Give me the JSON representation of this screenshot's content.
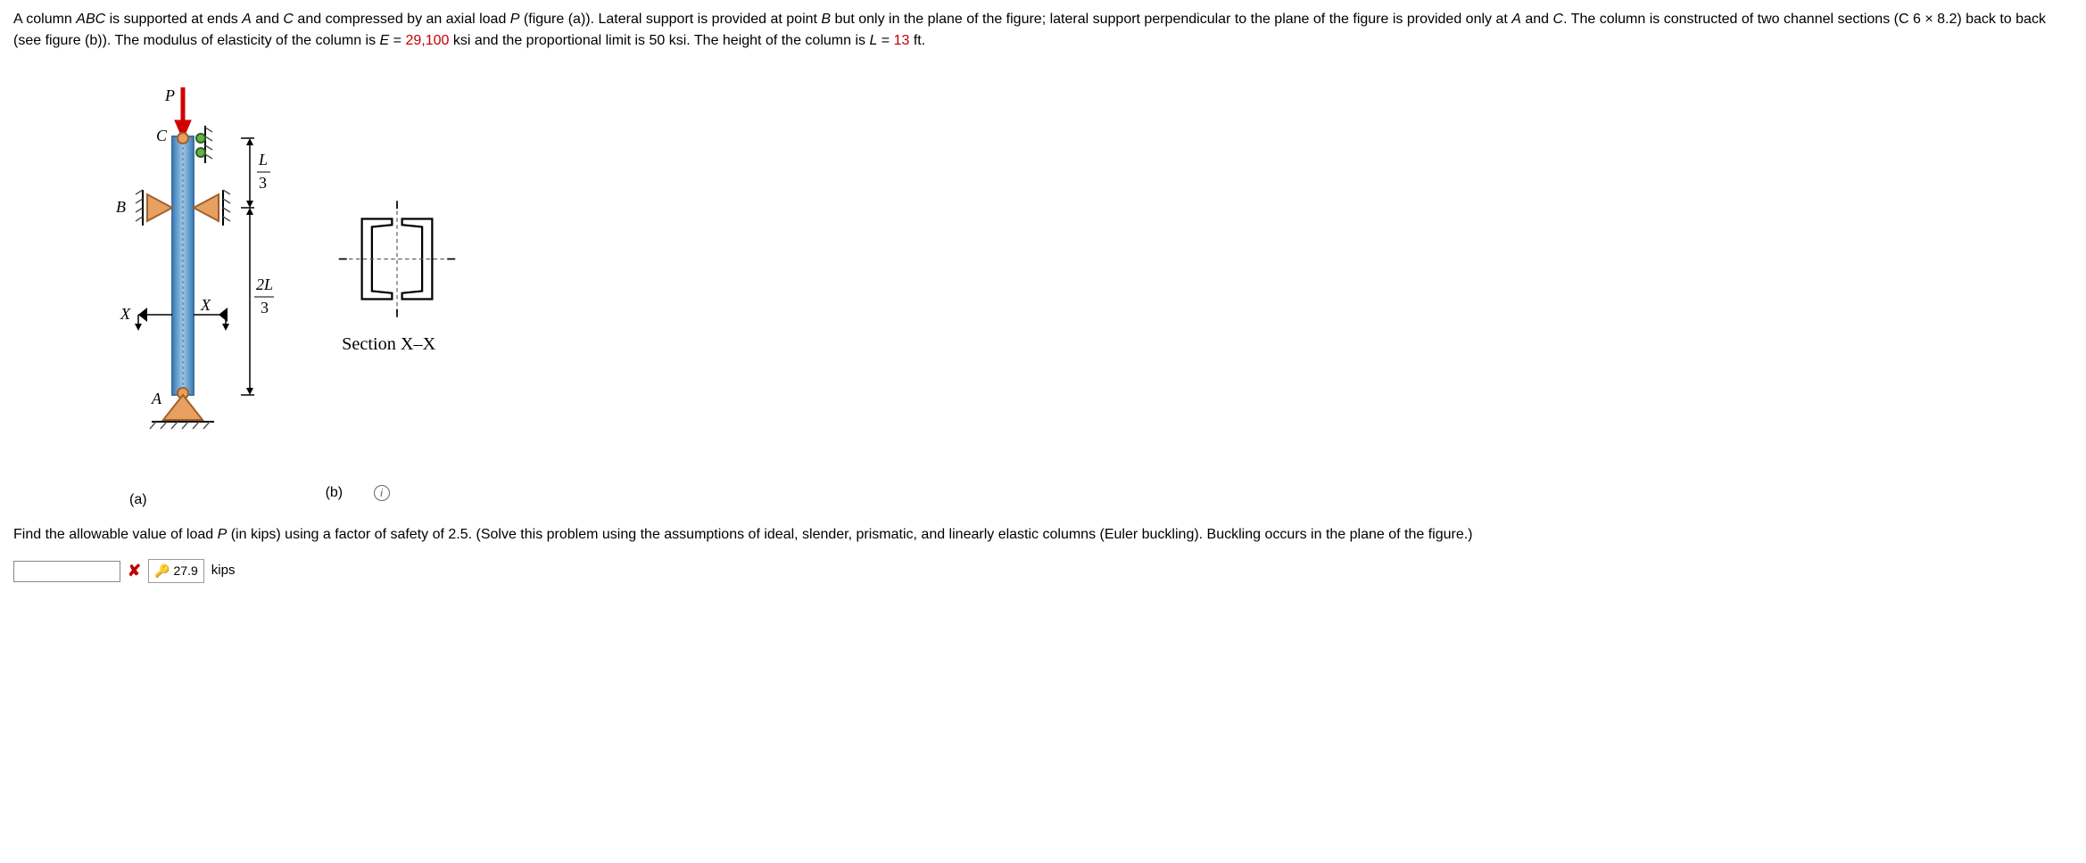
{
  "problem": {
    "p1_a": "A column ",
    "p1_abc": "ABC",
    "p1_b": " is supported at ends ",
    "p1_A": "A",
    "p1_c": " and ",
    "p1_C1": "C",
    "p1_d": " and compressed by an axial load ",
    "p1_P": "P",
    "p1_e": " (figure (a)). Lateral support is provided at point ",
    "p1_B": "B",
    "p1_f": " but only in the plane of the figure; lateral support perpendicular to the plane of the figure is provided only at ",
    "p1_A2": "A",
    "p1_g": " and ",
    "p1_C2": "C",
    "p1_h": ". The column is constructed of two channel sections (C 6 × 8.2) back to back (see figure (b)). The modulus of elasticity of the column is ",
    "p1_E": "E",
    "p1_i": " = ",
    "p1_Eval": "29,100",
    "p1_j": " ksi and the proportional limit is 50 ksi. The height of the column is ",
    "p1_L": "L",
    "p1_k": " = ",
    "p1_Lval": "13",
    "p1_m": " ft."
  },
  "figure_a": {
    "P": "P",
    "C": "C",
    "B": "B",
    "X1": "X",
    "X2": "X",
    "A": "A",
    "dim_top_num": "L",
    "dim_top_den": "3",
    "dim_bot_num": "2L",
    "dim_bot_den": "3",
    "label": "(a)"
  },
  "figure_b": {
    "section_label": "Section X–X",
    "label": "(b)"
  },
  "info_tooltip": "i",
  "question": {
    "q1": "Find the allowable value of load ",
    "q_P": "P",
    "q2": " (in kips) using a factor of safety of 2.5. (Solve this problem using the assumptions of ideal, slender, prismatic, and linearly elastic columns (Euler buckling). Buckling occurs in the plane of the figure.)"
  },
  "answer": {
    "input_value": "",
    "correct_value": "27.9",
    "unit": "kips"
  }
}
